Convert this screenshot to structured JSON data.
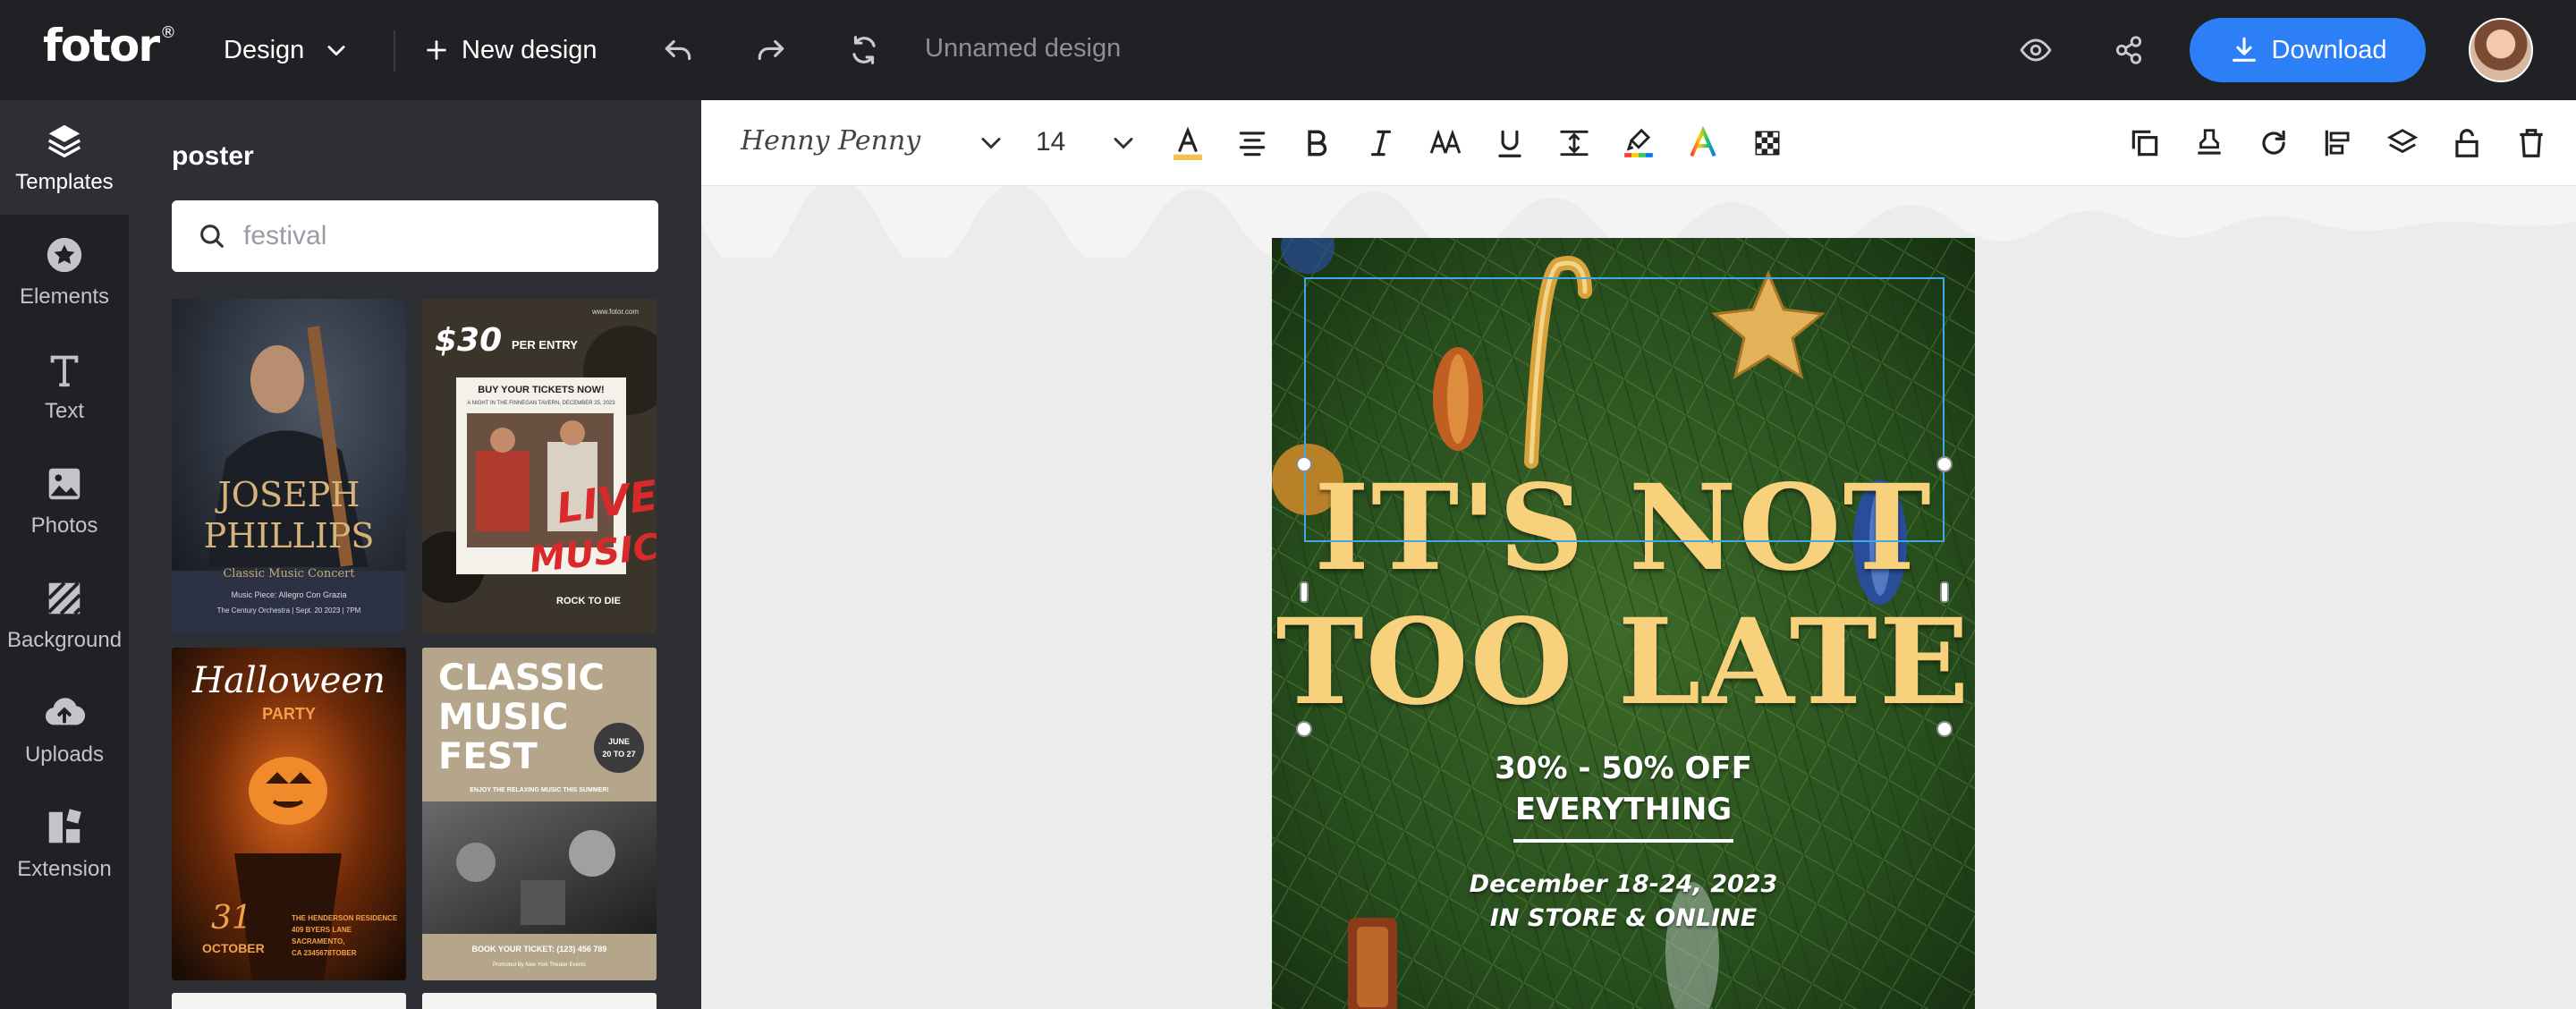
{
  "app": {
    "brand": "fotor",
    "design_menu_label": "Design",
    "new_design_label": "New design",
    "design_name": "Unnamed design",
    "download_label": "Download"
  },
  "sidebar": {
    "items": [
      {
        "label": "Templates",
        "icon": "templates-icon",
        "active": true
      },
      {
        "label": "Elements",
        "icon": "elements-icon",
        "active": false
      },
      {
        "label": "Text",
        "icon": "text-icon",
        "active": false
      },
      {
        "label": "Photos",
        "icon": "photos-icon",
        "active": false
      },
      {
        "label": "Background",
        "icon": "background-icon",
        "active": false
      },
      {
        "label": "Uploads",
        "icon": "uploads-icon",
        "active": false
      },
      {
        "label": "Extension",
        "icon": "extension-icon",
        "active": false
      }
    ]
  },
  "panel": {
    "title": "poster",
    "search_placeholder": "festival",
    "templates": [
      {
        "id": "joseph",
        "title_line1": "JOSEPH",
        "title_line2": "PHILLIPS",
        "subtitle": "Classic Music Concert",
        "line1": "Music Piece: Allegro Con Grazia",
        "line2": "The Century Orchestra | Sept. 20 2023 | 7PM"
      },
      {
        "id": "live",
        "price": "$30",
        "per_entry": "PER ENTRY",
        "tickets": "BUY YOUR TICKETS NOW!",
        "tagline": "A NIGHT IN THE FINNEGAN TAVERN, DECEMBER 25, 2023",
        "live": "LIVE",
        "music": "MUSIC",
        "rock": "ROCK TO DIE",
        "url": "www.fotor.com"
      },
      {
        "id": "halloween",
        "script": "Halloween",
        "party": "PARTY",
        "day": "31",
        "month": "OCTOBER",
        "info1": "THE HENDERSON RESIDENCE",
        "info2": "409 BYERS LANE SACRAMENTO,",
        "info3": "CA 2345678TOBER"
      },
      {
        "id": "classic",
        "title1": "CLASSIC",
        "title2": "MUSIC",
        "title3": "FEST",
        "badge_month": "JUNE",
        "badge_days": "20 TO 27",
        "enjoy": "ENJOY THE RELAXING MUSIC THIS SUMMER!",
        "book": "BOOK YOUR TICKET: (123) 456 789",
        "promo": "Promoted By New York Theater Events"
      }
    ]
  },
  "toolbar": {
    "font_name": "Henny Penny",
    "font_size": "14",
    "text_color": "#f2c14e"
  },
  "poster": {
    "headline_line1": "IT'S NOT",
    "headline_line2": "TOO LATE",
    "discount_line1": "30% - 50% OFF",
    "discount_line2": "EVERYTHING",
    "dates_line1": "December 18-24, 2023",
    "dates_line2": "IN STORE & ONLINE",
    "headline_color": "#f7d17b"
  },
  "colors": {
    "topbar": "#202125",
    "panel": "#2e2f34",
    "accent": "#2c7ff7",
    "selection": "#3fa9e8"
  }
}
